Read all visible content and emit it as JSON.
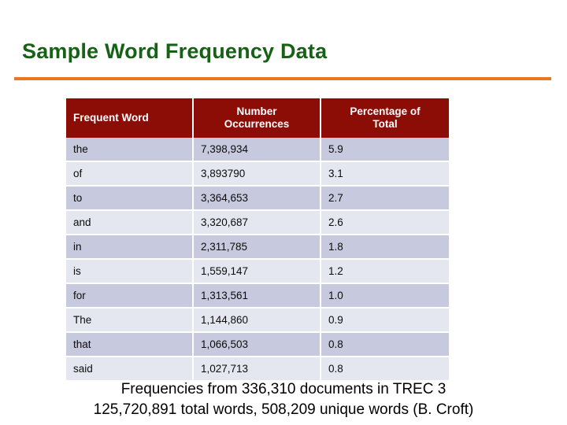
{
  "slide": {
    "title": "Sample Word Frequency Data",
    "title_color": "#176117",
    "rule_color": "#e8771f",
    "background": "#ffffff"
  },
  "table": {
    "header_bg": "#8b0d06",
    "header_text_color": "#ffffff",
    "row_odd_bg": "#c7cade",
    "row_even_bg": "#e5e7f0",
    "columns": [
      {
        "key": "word",
        "label": "Frequent Word",
        "align": "left"
      },
      {
        "key": "count",
        "label_line1": "Number",
        "label_line2": "Occurrences",
        "align": "center"
      },
      {
        "key": "percent",
        "label_line1": "Percentage of",
        "label_line2": "Total",
        "align": "center"
      }
    ],
    "rows": [
      {
        "word": "the",
        "count": "7,398,934",
        "percent": "5.9"
      },
      {
        "word": "of",
        "count": "3,893790",
        "percent": "3.1"
      },
      {
        "word": "to",
        "count": "3,364,653",
        "percent": "2.7"
      },
      {
        "word": "and",
        "count": "3,320,687",
        "percent": "2.6"
      },
      {
        "word": "in",
        "count": "2,311,785",
        "percent": "1.8"
      },
      {
        "word": "is",
        "count": "1,559,147",
        "percent": "1.2"
      },
      {
        "word": "for",
        "count": "1,313,561",
        "percent": "1.0"
      },
      {
        "word": "The",
        "count": "1,144,860",
        "percent": "0.9"
      },
      {
        "word": "that",
        "count": "1,066,503",
        "percent": "0.8"
      },
      {
        "word": "said",
        "count": "1,027,713",
        "percent": "0.8"
      }
    ]
  },
  "footer": {
    "line1": "Frequencies from 336,310 documents in TREC 3",
    "line2": "125,720,891 total words, 508,209 unique words (B. Croft)"
  }
}
